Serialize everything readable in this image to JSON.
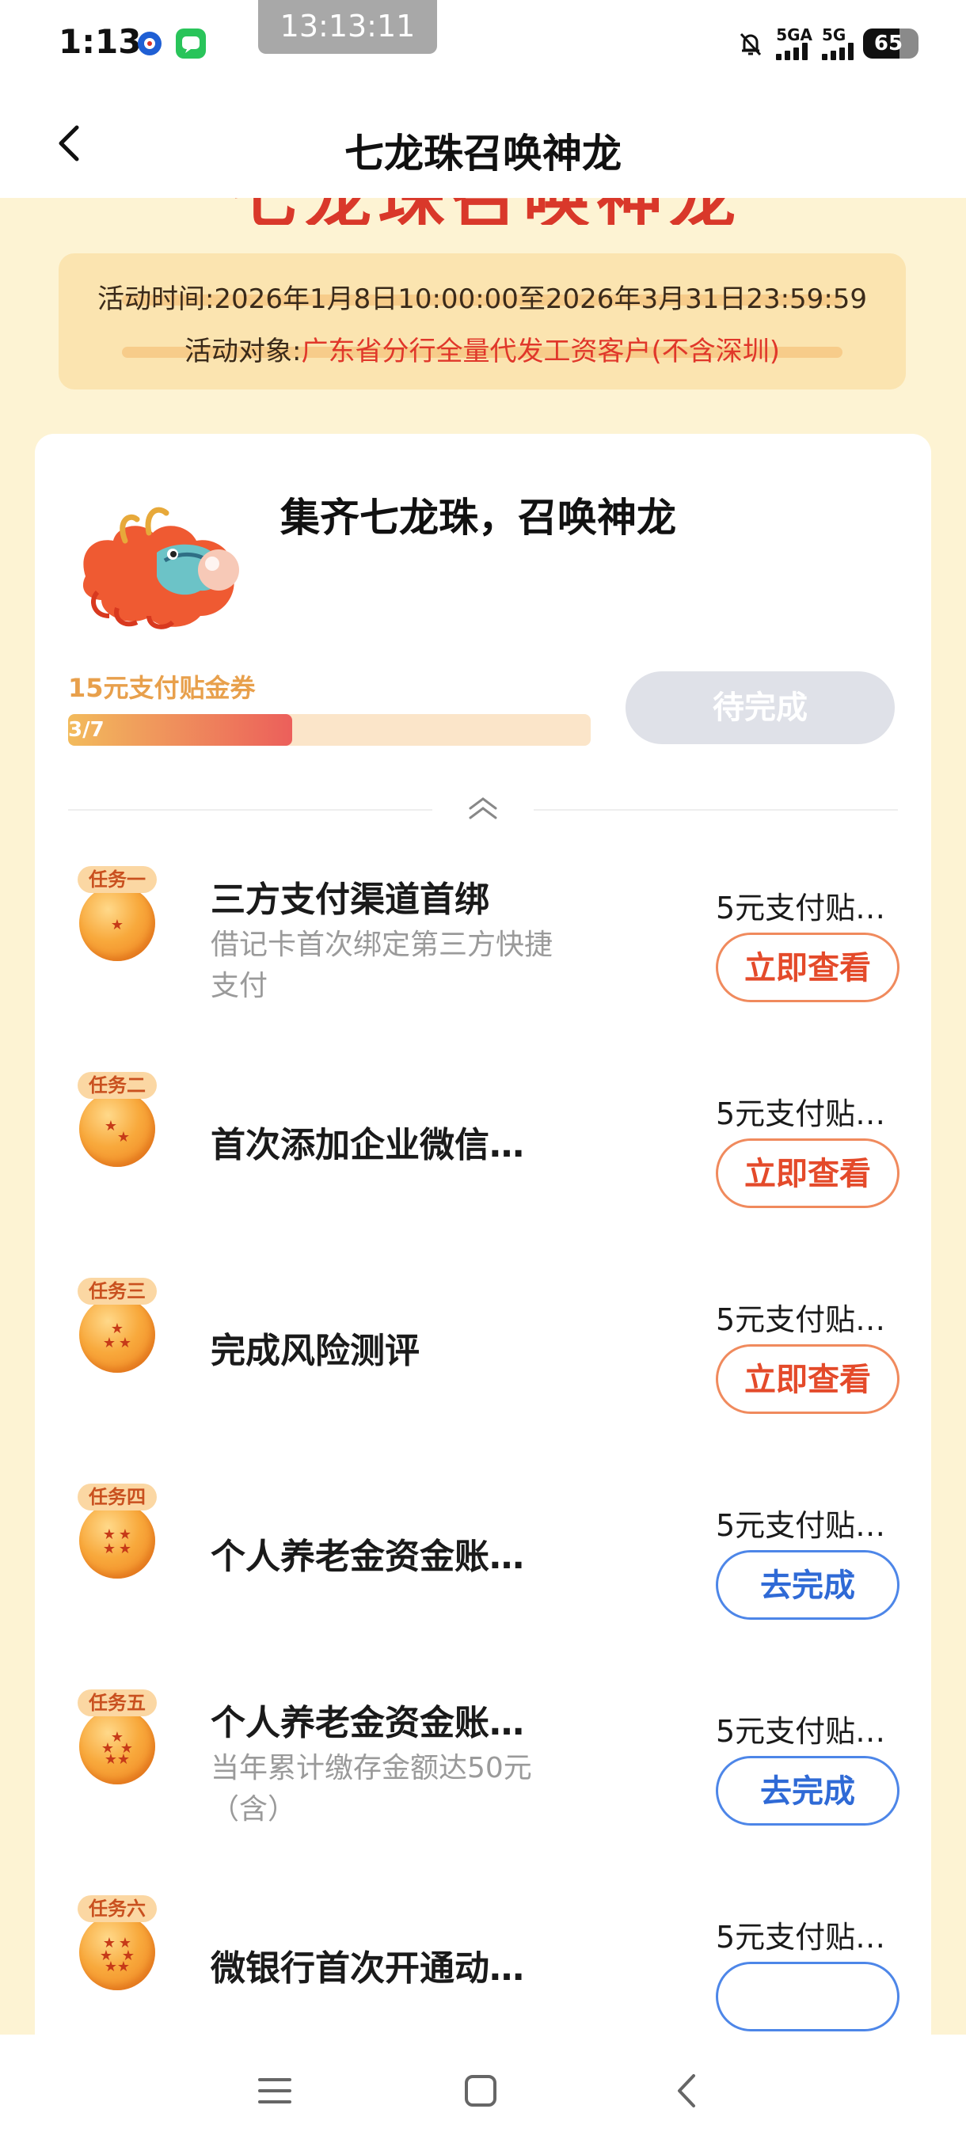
{
  "status_bar": {
    "time": "1:13",
    "clock_overlay": "13:13:11",
    "network_1": "5GA",
    "network_2": "5G",
    "battery": "65",
    "battery_level": 0.65
  },
  "nav": {
    "title": "七龙珠召唤神龙"
  },
  "banner": {
    "title_partial": "七龙珠召唤神龙"
  },
  "info": {
    "time_label": "活动时间:",
    "time_value": "2026年1月8日10:00:00至2026年3月31日23:59:59",
    "target_label": "活动对象:",
    "target_value": "广东省分行全量代发工资客户(不含深圳)"
  },
  "card": {
    "title": "集齐七龙珠，召唤神龙",
    "reward_label": "15元支付贴金券",
    "progress_text": "3/7",
    "progress_fraction": 0.4286,
    "pending_button": "待完成"
  },
  "tasks": [
    {
      "badge": "任务一",
      "stars": 1,
      "title": "三方支付渠道首绑",
      "desc": "借记卡首次绑定第三方快捷支付",
      "reward": "5元支付贴…",
      "button": "立即查看",
      "button_style": "orange"
    },
    {
      "badge": "任务二",
      "stars": 2,
      "title": "首次添加企业微信…",
      "desc": "",
      "reward": "5元支付贴…",
      "button": "立即查看",
      "button_style": "orange"
    },
    {
      "badge": "任务三",
      "stars": 3,
      "title": "完成风险测评",
      "desc": "",
      "reward": "5元支付贴…",
      "button": "立即查看",
      "button_style": "orange"
    },
    {
      "badge": "任务四",
      "stars": 4,
      "title": "个人养老金资金账…",
      "desc": "",
      "reward": "5元支付贴…",
      "button": "去完成",
      "button_style": "blue"
    },
    {
      "badge": "任务五",
      "stars": 5,
      "title": "个人养老金资金账…",
      "desc": "当年累计缴存金额达50元（含）",
      "reward": "5元支付贴…",
      "button": "去完成",
      "button_style": "blue"
    },
    {
      "badge": "任务六",
      "stars": 6,
      "title": "微银行首次开通动…",
      "desc": "",
      "reward": "5元支付贴…",
      "button": "",
      "button_style": "blue"
    }
  ],
  "colors": {
    "page_bg": "#fdf3d3",
    "accent_red": "#e0372a",
    "orange_btn": "#e44a2a",
    "blue_btn": "#2f6ad6",
    "progress_start": "#f2bb5c",
    "progress_end": "#ec5f5b"
  },
  "icons": {
    "back": "chevron-left-icon",
    "collapse": "double-chevron-up-icon",
    "bottom_menu": "menu-icon",
    "bottom_home": "home-square-icon",
    "bottom_back": "back-icon"
  }
}
